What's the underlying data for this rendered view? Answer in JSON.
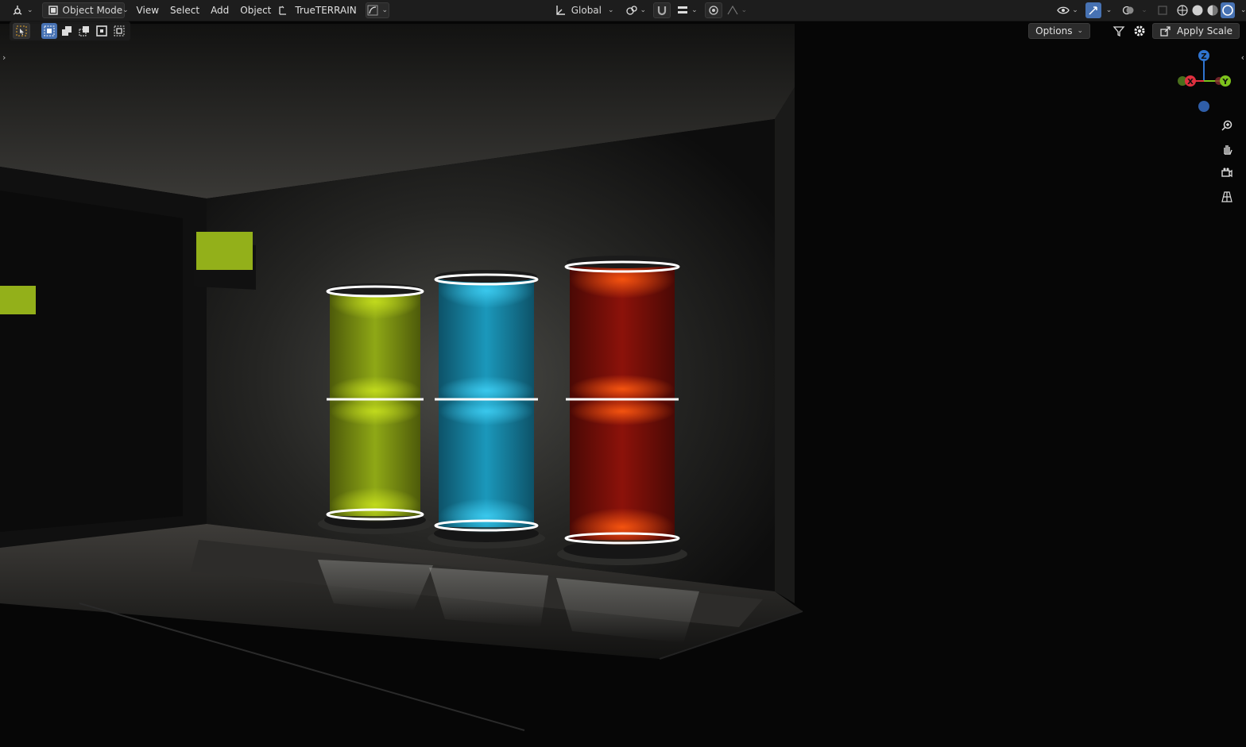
{
  "header": {
    "editor_type_icon": "3d-viewport-icon",
    "mode": {
      "icon": "object-mode-icon",
      "label": "Object Mode"
    },
    "menus": [
      "View",
      "Select",
      "Add",
      "Object"
    ],
    "addon_label": "TrueTERRAIN",
    "transform_orientation": "Global",
    "icons": {
      "addon": "terrain-icon",
      "curve": "curve-icon",
      "orientation": "axes-icon",
      "pivot": "pivot-icon",
      "snap": "magnet-icon",
      "snap_target": "snap-increment-icon",
      "proportional": "proportional-edit-icon",
      "falloff": "falloff-icon",
      "visibility": "eye-icon",
      "gizmo": "gizmo-icon",
      "overlay": "overlay-icon",
      "xray": "xray-icon",
      "shading_wire": "wireframe-shading-icon",
      "shading_solid": "solid-shading-icon",
      "shading_material": "material-shading-icon",
      "shading_rendered": "rendered-shading-icon",
      "pause": "pause-icon"
    }
  },
  "toolbar": {
    "select_tool_icon": "select-box-icon",
    "select_modes": [
      "select-new-icon",
      "select-extend-icon",
      "select-subtract-icon",
      "select-intersect-icon"
    ],
    "options_label": "Options",
    "apply_scale_label": "Apply Scale"
  },
  "gizmo": {
    "z": "Z",
    "x": "X",
    "y": "Y"
  },
  "nav_tools": [
    "zoom-icon",
    "pan-hand-icon",
    "camera-icon",
    "perspective-grid-icon"
  ],
  "colors": {
    "accent": "#4772b3",
    "tube_green": "#a8c41a",
    "tube_cyan": "#1fa6c9",
    "tube_red": "#b01a0e",
    "axis_x": "#e0303f",
    "axis_y": "#7dc21c",
    "axis_z": "#2f74d0"
  }
}
